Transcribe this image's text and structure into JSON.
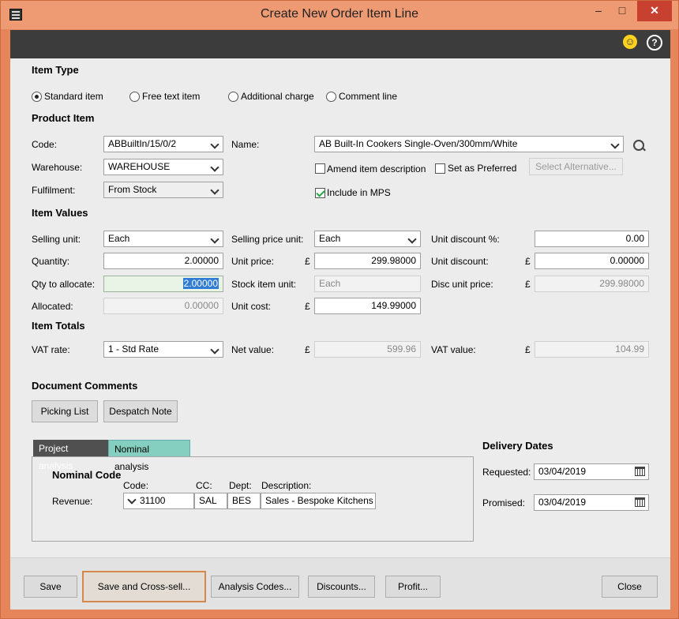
{
  "window": {
    "title": "Create New Order Item Line",
    "minimize": "–",
    "maximize": "□",
    "close": "✕",
    "icons": [
      "app-icon",
      "smiley-icon",
      "help-icon"
    ]
  },
  "item_type": {
    "heading": "Item Type",
    "options": [
      "Standard item",
      "Free text item",
      "Additional charge",
      "Comment line"
    ],
    "selected": "Standard item"
  },
  "product_item": {
    "heading": "Product Item",
    "code_label": "Code:",
    "code_value": "ABBuiltIn/15/0/2",
    "name_label": "Name:",
    "name_value": "AB Built-In Cookers Single-Oven/300mm/White",
    "warehouse_label": "Warehouse:",
    "warehouse_value": "WAREHOUSE",
    "fulfilment_label": "Fulfilment:",
    "fulfilment_value": "From Stock",
    "amend_label": "Amend item description",
    "preferred_label": "Set as Preferred",
    "select_alt_label": "Select Alternative...",
    "include_mps_label": "Include in MPS",
    "include_mps_checked": true
  },
  "item_values": {
    "heading": "Item Values",
    "selling_unit_label": "Selling unit:",
    "selling_unit_value": "Each",
    "quantity_label": "Quantity:",
    "quantity_value": "2.00000",
    "qty_allocate_label": "Qty to allocate:",
    "qty_allocate_value": "2.00000",
    "allocated_label": "Allocated:",
    "allocated_value": "0.00000",
    "selling_price_unit_label": "Selling price unit:",
    "selling_price_unit_value": "Each",
    "unit_price_label": "Unit price:",
    "unit_price_value": "299.98000",
    "stock_item_unit_label": "Stock item unit:",
    "stock_item_unit_value": "Each",
    "unit_cost_label": "Unit cost:",
    "unit_cost_value": "149.99000",
    "unit_discount_pct_label": "Unit discount %:",
    "unit_discount_pct_value": "0.00",
    "unit_discount_label": "Unit discount:",
    "unit_discount_value": "0.00000",
    "disc_unit_price_label": "Disc unit price:",
    "disc_unit_price_value": "299.98000",
    "currency": "£"
  },
  "item_totals": {
    "heading": "Item Totals",
    "vat_rate_label": "VAT rate:",
    "vat_rate_value": "1 - Std Rate",
    "net_value_label": "Net value:",
    "net_value": "599.96",
    "vat_value_label": "VAT value:",
    "vat_value": "104.99"
  },
  "document_comments": {
    "heading": "Document Comments",
    "picking_list": "Picking List",
    "despatch_note": "Despatch Note"
  },
  "analysis": {
    "tabs": [
      "Project analysis",
      "Nominal analysis"
    ],
    "active_tab": "Nominal analysis",
    "nominal_heading": "Nominal Code",
    "code_header": "Code:",
    "cc_header": "CC:",
    "dept_header": "Dept:",
    "description_header": "Description:",
    "row_label": "Revenue:",
    "code_value": "31100",
    "cc_value": "SAL",
    "dept_value": "BES",
    "description_value": "Sales - Bespoke Kitchens"
  },
  "delivery_dates": {
    "heading": "Delivery Dates",
    "requested_label": "Requested:",
    "requested_value": "03/04/2019",
    "promised_label": "Promised:",
    "promised_value": "03/04/2019"
  },
  "buttons": {
    "save": "Save",
    "save_cross_sell": "Save and Cross-sell...",
    "analysis_codes": "Analysis Codes...",
    "discounts": "Discounts...",
    "profit": "Profit...",
    "close": "Close"
  }
}
